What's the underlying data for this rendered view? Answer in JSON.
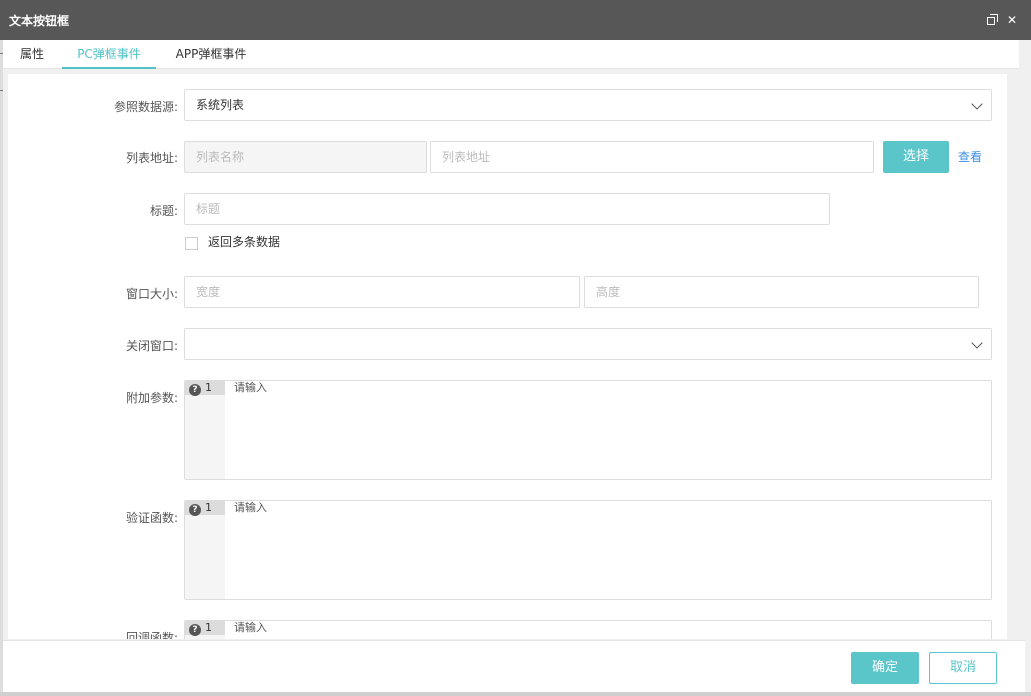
{
  "window": {
    "title": "文本按钮框"
  },
  "tabs": [
    {
      "label": "属性"
    },
    {
      "label": "PC弹框事件"
    },
    {
      "label": "APP弹框事件"
    }
  ],
  "form": {
    "data_source": {
      "label": "参照数据源:",
      "value": "系统列表"
    },
    "list_address": {
      "label": "列表地址:",
      "name_placeholder": "列表名称",
      "address_placeholder": "列表地址",
      "select_button": "选择",
      "view_link": "查看"
    },
    "title": {
      "label": "标题:",
      "placeholder": "标题"
    },
    "return_multiple": {
      "label": "返回多条数据",
      "checked": false
    },
    "window_size": {
      "label": "窗口大小:",
      "width_placeholder": "宽度",
      "height_placeholder": "高度"
    },
    "close_window": {
      "label": "关闭窗口:",
      "value": ""
    },
    "extra_params": {
      "label": "附加参数:",
      "line_no": "1",
      "placeholder": "请输入"
    },
    "validate_fn": {
      "label": "验证函数:",
      "line_no": "1",
      "placeholder": "请输入"
    },
    "callback_fn": {
      "label": "回调函数:",
      "line_no": "1",
      "placeholder": "请输入"
    }
  },
  "footer": {
    "ok": "确定",
    "cancel": "取消"
  },
  "colors": {
    "accent": "#5bc6c9",
    "titlebar": "#575757",
    "link": "#3a8ee6"
  },
  "icons": {
    "restore": "restore-window-icon",
    "close": "close-icon",
    "dropdown": "chevron-down-icon",
    "help": "question-circle-icon"
  }
}
